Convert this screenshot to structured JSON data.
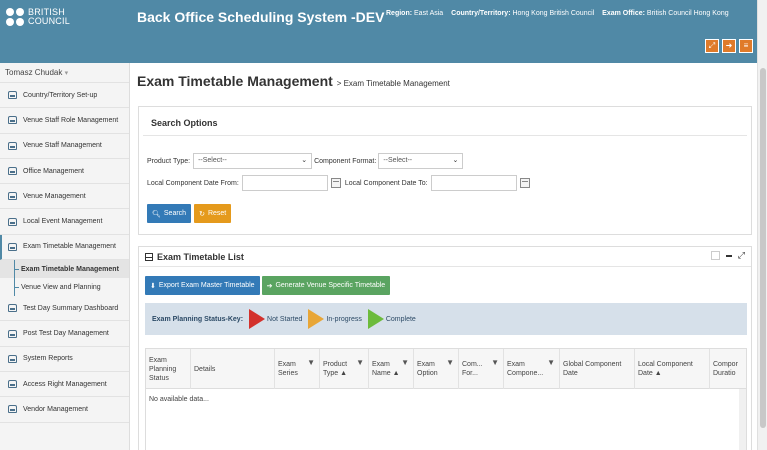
{
  "brand": {
    "line1": "BRITISH",
    "line2": "COUNCIL"
  },
  "app_title": "Back Office Scheduling System -DEV",
  "context": {
    "region_label": "Region:",
    "region_value": "East Asia",
    "country_label": "Country/Territory:",
    "country_value": "Hong Kong British Council",
    "office_label": "Exam Office:",
    "office_value": "British Council Hong Kong"
  },
  "header_buttons": [
    {
      "icon": "fullscreen-icon",
      "glyph": "⤢"
    },
    {
      "icon": "logout-icon",
      "glyph": "➜"
    },
    {
      "icon": "menu-icon",
      "glyph": "≡"
    }
  ],
  "colors": {
    "header": "#5089a6",
    "accent_orange": "#e07b2a",
    "btn_blue": "#337ab7",
    "btn_orange": "#e59a1c",
    "btn_green": "#5aa461"
  },
  "user": {
    "name": "Tomasz Chudak",
    "caret": "▾"
  },
  "sidebar": {
    "items": [
      {
        "label": "Country/Territory Set-up"
      },
      {
        "label": "Venue Staff Role Management"
      },
      {
        "label": "Venue Staff Management"
      },
      {
        "label": "Office Management"
      },
      {
        "label": "Venue Management"
      },
      {
        "label": "Local Event Management"
      },
      {
        "label": "Exam Timetable Management"
      },
      {
        "label": "Test Day Summary Dashboard"
      },
      {
        "label": "Post Test Day Management"
      },
      {
        "label": "System Reports"
      },
      {
        "label": "Access Right Management"
      },
      {
        "label": "Vendor Management"
      }
    ],
    "sub_items": [
      {
        "label": "Exam Timetable Management"
      },
      {
        "label": "Venue View and Planning"
      }
    ]
  },
  "page": {
    "title": "Exam Timetable Management",
    "breadcrumb": "> Exam Timetable Management"
  },
  "search": {
    "heading": "Search Options",
    "product_type_label": "Product Type:",
    "product_type_value": "--Select--",
    "component_format_label": "Component Format:",
    "component_format_value": "--Select--",
    "date_from_label": "Local Component Date From:",
    "date_to_label": "Local Component Date To:",
    "search_btn": "Search",
    "reset_btn": "Reset"
  },
  "list": {
    "heading": "Exam Timetable List",
    "export_btn": "Export Exam Master Timetable",
    "generate_btn": "Generate Venue Specific Timetable",
    "status_key_label": "Exam Planning Status-Key:",
    "status_not_started": "Not Started",
    "status_in_progress": "In-progress",
    "status_complete": "Complete",
    "columns": [
      {
        "label": "Exam Planning Status"
      },
      {
        "label": "Details"
      },
      {
        "label": "Exam Series"
      },
      {
        "label": "Product Type ▲"
      },
      {
        "label": "Exam Name ▲"
      },
      {
        "label": "Exam Option"
      },
      {
        "label": "Com... For..."
      },
      {
        "label": "Exam Compone..."
      },
      {
        "label": "Global Component Date"
      },
      {
        "label": "Local Component Date ▲"
      },
      {
        "label": "Compor Duratio"
      }
    ],
    "filter_glyph": "▼",
    "empty_text": "No available data..."
  }
}
